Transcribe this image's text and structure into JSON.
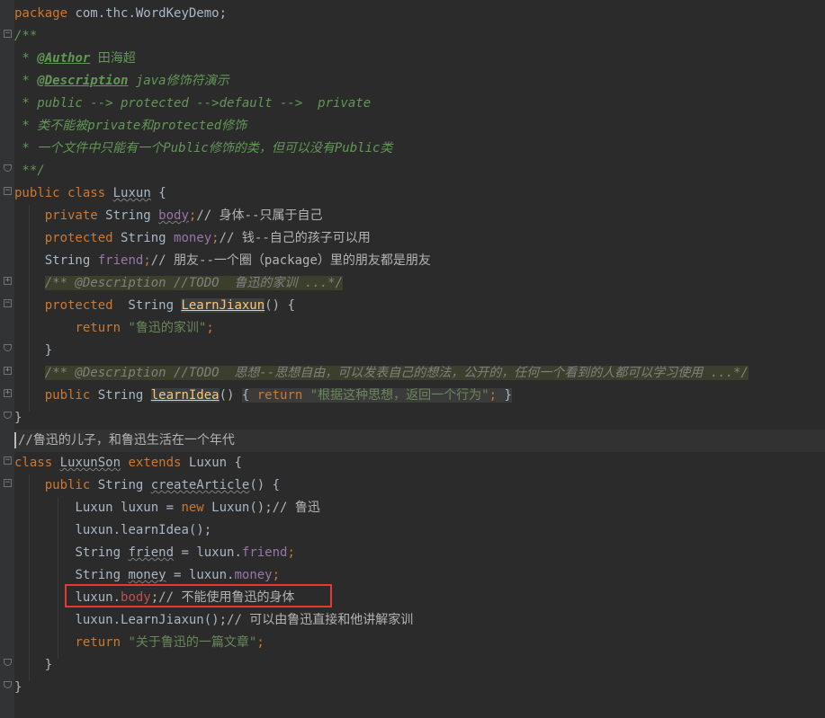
{
  "code": {
    "package_line": [
      "package",
      " com.thc.WordKeyDemo;"
    ],
    "javadoc_open": "/**",
    "author_tag": "@Author",
    "author_value": " 田海超",
    "description_tag": "@Description",
    "description_value": " java修饰符演示",
    "modifiers_line": " * public --> protected -->default -->  private",
    "class_rule_line": " * 类不能被private和protected修饰",
    "file_rule_line": " * 一个文件中只能有一个Public修饰的类，但可以没有Public类",
    "javadoc_close": " **/",
    "class_decl": {
      "kw1": "public",
      "kw2": "class",
      "name": "Luxun",
      "brace": " {"
    },
    "field_body": {
      "kw": "private",
      "type": " String ",
      "name": "body",
      "comment": "// 身体--只属于自己"
    },
    "field_money": {
      "kw": "protected",
      "type": " String ",
      "name": "money",
      "comment": "// 钱--自己的孩子可以用"
    },
    "field_friend": {
      "type": "String ",
      "name": "friend",
      "comment": "// 朋友--一个圈（package）里的朋友都是朋友"
    },
    "folded_doc_1": "/** @Description //TODO  鲁迅的家训 ...*/",
    "method_learn": {
      "kw": "protected",
      "type": "  String ",
      "name": "LearnJiaxun",
      "tail": "() {"
    },
    "return_1": {
      "kw": "return",
      "value": "\"鲁迅的家训\""
    },
    "close_brace_inner": "}",
    "folded_doc_2": "/** @Description //TODO  思想--思想自由，可以发表自己的想法，公开的，任何一个看到的人都可以学习使用 ...*/",
    "method_idea": {
      "kw": "public",
      "type": " String ",
      "name": "learnIdea",
      "open": "() ",
      "body_open": "{ ",
      "ret": "return",
      "value": " \"根据这种思想，返回一个行为\"",
      "semi": ";",
      "body_close": " }"
    },
    "close_brace_outer": "}",
    "son_comment": "//鲁迅的儿子，和鲁迅生活在一个年代",
    "son_decl": {
      "kw1": "class",
      "name": "LuxunSon",
      "kw2": "extends",
      "parent": " Luxun {"
    },
    "create_article": {
      "kw": "public",
      "type": " String ",
      "name": "createArticle",
      "tail": "() {"
    },
    "new_luxun": {
      "pre": "Luxun luxun = ",
      "kw": "new",
      "post": " Luxun()",
      "comment": ";// 鲁迅"
    },
    "call_idea": "luxun.learnIdea();",
    "assign_friend": {
      "type": "String ",
      "name": "friend",
      "mid": " = luxun.",
      "field": "friend",
      "end": ";"
    },
    "assign_money": {
      "type": "String ",
      "name": "money",
      "mid": " = luxun.",
      "field": "money",
      "end": ";"
    },
    "access_body": {
      "pre": "luxun.",
      "field": "body",
      "comment": ";// 不能使用鲁迅的身体"
    },
    "call_learn": {
      "pre": "luxun.LearnJiaxun()",
      "comment": ";// 可以由鲁迅直接和他讲解家训"
    },
    "return_2": {
      "kw": "return",
      "value": " \"关于鲁迅的一篇文章\"",
      "end": ";"
    }
  }
}
